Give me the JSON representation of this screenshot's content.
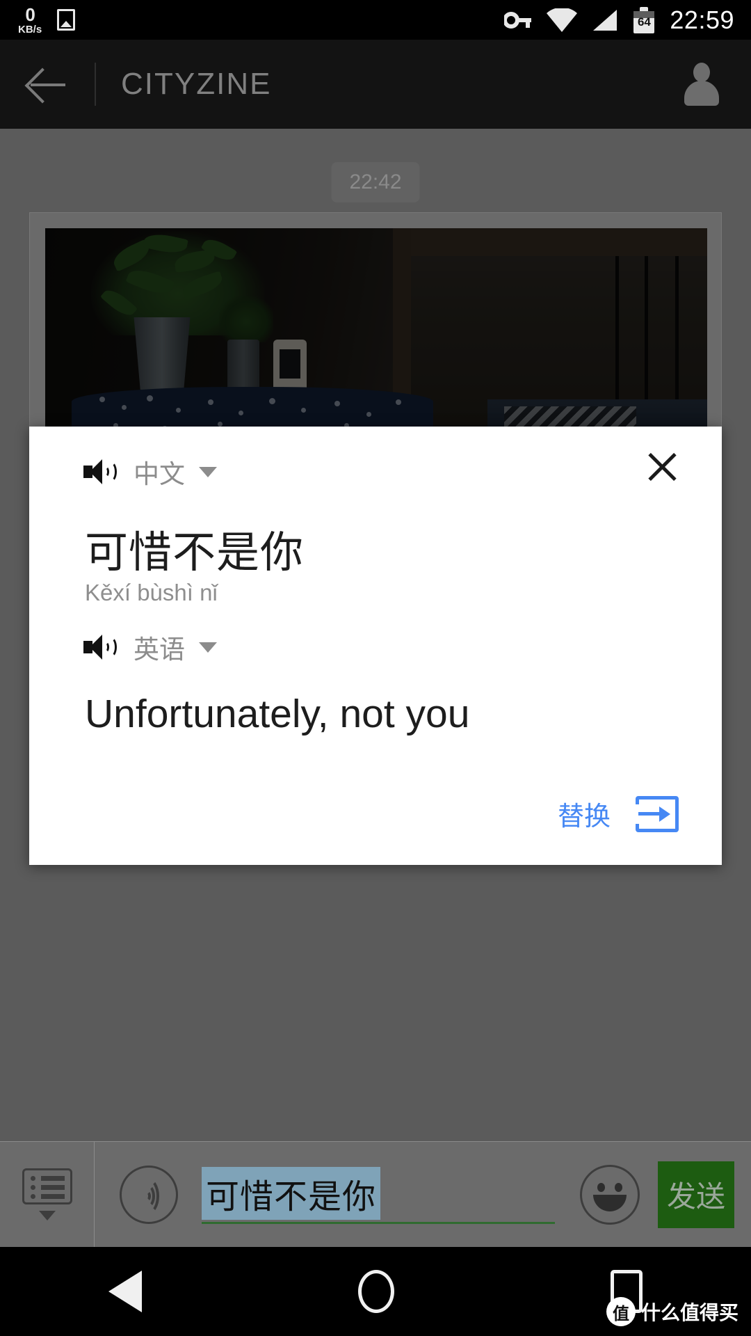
{
  "status_bar": {
    "net_speed_value": "0",
    "net_speed_unit": "KB/s",
    "photo_icon": "image-icon",
    "vpn_key_icon": "key-icon",
    "wifi_icon": "wifi-icon",
    "signal_icon": "signal-icon",
    "battery_level": "64",
    "clock": "22:59"
  },
  "app_bar": {
    "back_icon": "back-arrow-icon",
    "title": "CITYZINE",
    "avatar_icon": "person-icon"
  },
  "chat": {
    "timestamp_chip": "22:42",
    "photo_alt": "potted plant on blue patterned tablecloth"
  },
  "dialog": {
    "source": {
      "speaker_icon": "speaker-icon",
      "language": "中文",
      "dropdown_icon": "chevron-down-icon",
      "text": "可惜不是你",
      "pinyin": "Kěxí bùshì nǐ"
    },
    "target": {
      "speaker_icon": "speaker-icon",
      "language": "英语",
      "dropdown_icon": "chevron-down-icon",
      "text": "Unfortunately, not you"
    },
    "close_icon": "close-icon",
    "replace_label": "替换",
    "replace_icon": "insert-arrow-icon",
    "accent_color": "#4688f4"
  },
  "input_bar": {
    "list_icon": "list-icon",
    "list_caret_icon": "chevron-down-icon",
    "voice_icon": "voice-input-icon",
    "text_value": "可惜不是你",
    "emoji_icon": "emoji-icon",
    "send_label": "发送",
    "send_color": "#1d5c11",
    "selection_color": "#7fa3b8"
  },
  "nav_bar": {
    "back_icon": "nav-back-icon",
    "home_icon": "nav-home-icon",
    "recents_icon": "nav-recents-icon"
  },
  "watermark": {
    "logo_char": "值",
    "text": "什么值得买"
  }
}
